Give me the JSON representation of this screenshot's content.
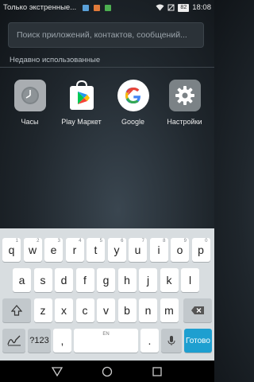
{
  "status_bar": {
    "carrier": "Только экстренные...",
    "battery": "82",
    "time": "18:08"
  },
  "search": {
    "placeholder": "Поиск приложений, контактов, сообщений..."
  },
  "recent": {
    "header": "Недавно использованные",
    "apps": [
      {
        "label": "Часы",
        "icon": "clock-icon"
      },
      {
        "label": "Play Маркет",
        "icon": "play-store-icon"
      },
      {
        "label": "Google",
        "icon": "google-icon"
      },
      {
        "label": "Настройки",
        "icon": "settings-icon"
      }
    ]
  },
  "keyboard": {
    "row1": [
      {
        "k": "q",
        "n": "1"
      },
      {
        "k": "w",
        "n": "2"
      },
      {
        "k": "e",
        "n": "3"
      },
      {
        "k": "r",
        "n": "4"
      },
      {
        "k": "t",
        "n": "5"
      },
      {
        "k": "y",
        "n": "6"
      },
      {
        "k": "u",
        "n": "7"
      },
      {
        "k": "i",
        "n": "8"
      },
      {
        "k": "o",
        "n": "9"
      },
      {
        "k": "p",
        "n": "0"
      }
    ],
    "row2": [
      "a",
      "s",
      "d",
      "f",
      "g",
      "h",
      "j",
      "k",
      "l"
    ],
    "row3": [
      "z",
      "x",
      "c",
      "v",
      "b",
      "n",
      "m"
    ],
    "symbols_label": "?123",
    "comma_label": ",",
    "space_label": "EN",
    "period_label": ".",
    "go_label": "Готово"
  },
  "colors": {
    "accent": "#1e9fd0"
  }
}
